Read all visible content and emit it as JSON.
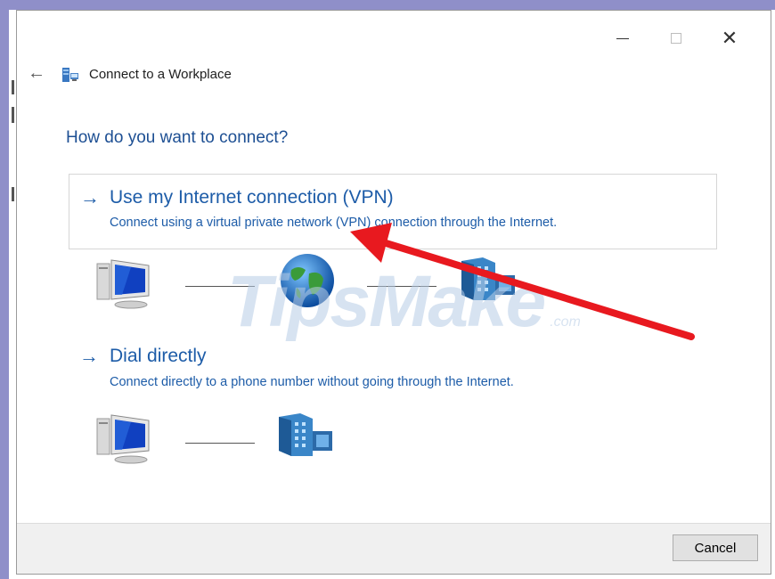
{
  "window": {
    "title": "Connect to a Workplace",
    "controls": {
      "minimize": "–",
      "maximize": "□",
      "close": "✕"
    }
  },
  "page": {
    "question": "How do you want to connect?"
  },
  "options": [
    {
      "title": "Use my Internet connection (VPN)",
      "description": "Connect using a virtual private network (VPN) connection through the Internet.",
      "icons": [
        "computer-icon",
        "globe-icon",
        "server-icon"
      ]
    },
    {
      "title": "Dial directly",
      "description": "Connect directly to a phone number without going through the Internet.",
      "icons": [
        "computer-icon",
        "server-icon"
      ]
    }
  ],
  "footer": {
    "cancel_label": "Cancel"
  },
  "watermark": {
    "text": "TipsMake",
    "suffix": ".com"
  },
  "colors": {
    "accent": "#1d5ca8",
    "annotation_arrow": "#e8191f",
    "frame": "#8f8fc9"
  }
}
